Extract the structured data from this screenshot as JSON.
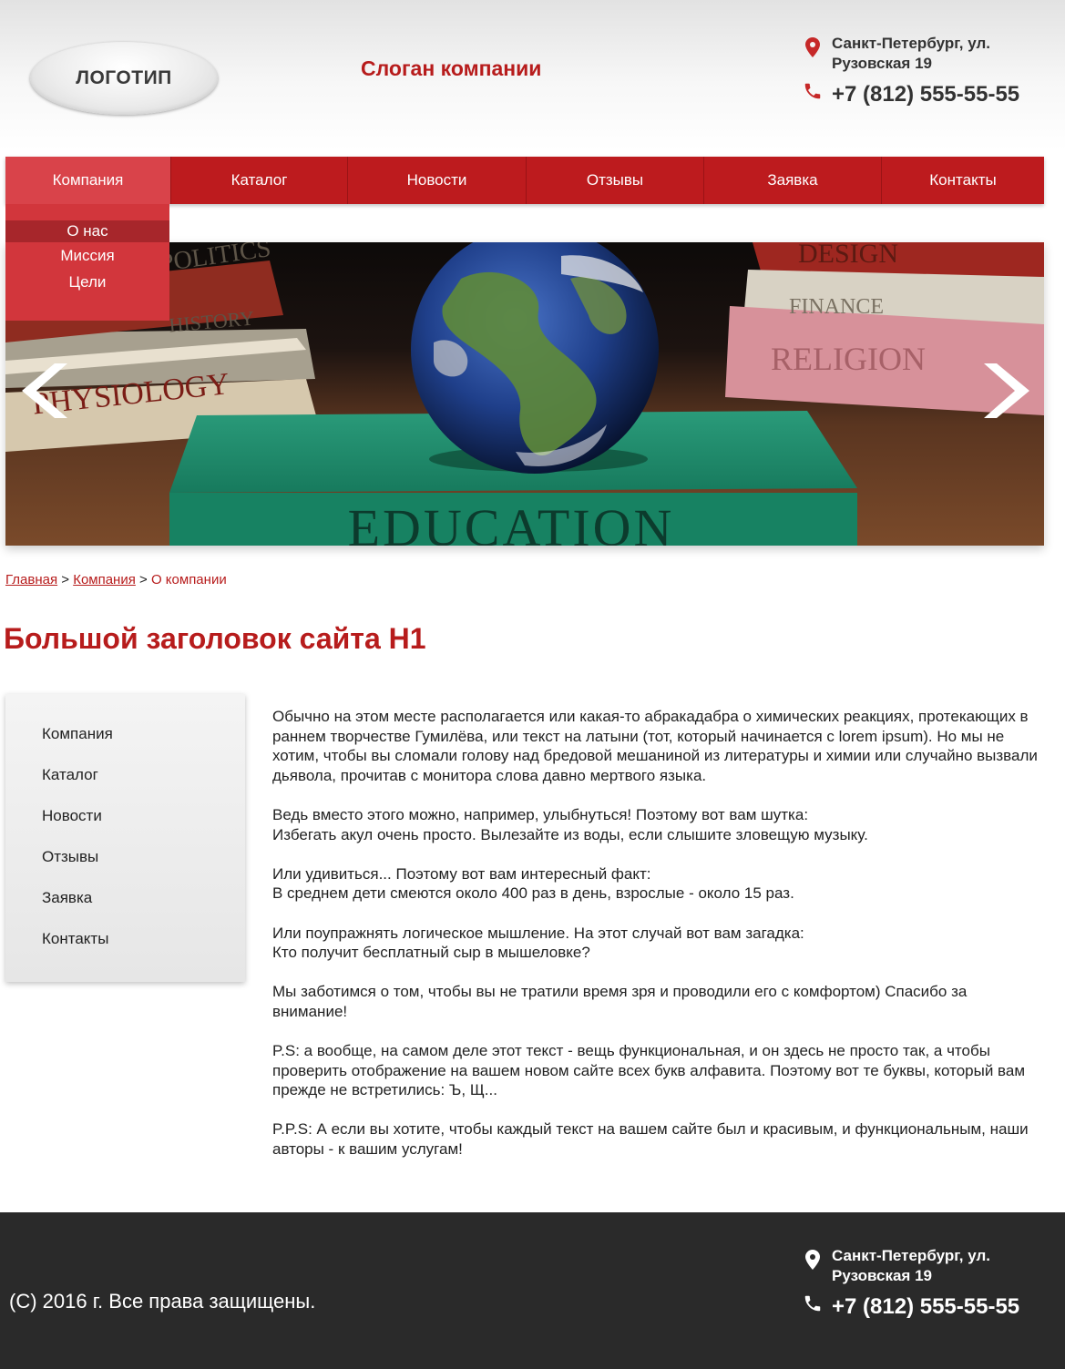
{
  "header": {
    "logo": "ЛОГОТИП",
    "slogan": "Слоган компании",
    "address": "Санкт-Петербург, ул. Рузовская 19",
    "phone": "+7 (812) 555-55-55"
  },
  "nav": {
    "items": [
      "Компания",
      "Каталог",
      "Новости",
      "Отзывы",
      "Заявка",
      "Контакты"
    ],
    "dropdown": [
      "О нас",
      "Миссия",
      "Цели"
    ]
  },
  "slider": {
    "book_text": "EDUCATION",
    "book_labels": [
      "PHYSIOLOGY",
      "HISTORY",
      "POLITICS",
      "DESIGN",
      "FINANCE",
      "RELIGION"
    ]
  },
  "breadcrumb": {
    "home": "Главная",
    "section": "Компания",
    "current": "О компании",
    "separator": ">"
  },
  "page_title": "Большой заголовок сайта H1",
  "sidebar": {
    "items": [
      "Компания",
      "Каталог",
      "Новости",
      "Отзывы",
      "Заявка",
      "Контакты"
    ]
  },
  "content": {
    "paragraphs": [
      [
        "Обычно на этом месте располагается или какая-то абракадабра о химических реакциях, протекающих в раннем творчестве Гумилёва, или текст на латыни (тот, который начинается с lorem ipsum). Но мы не хотим, чтобы вы сломали голову над бредовой мешаниной из литературы и химии или случайно вызвали дьявола, прочитав с монитора слова давно мертвого языка."
      ],
      [
        "Ведь вместо этого можно, например, улыбнуться! Поэтому вот вам шутка:",
        "Избегать акул очень просто. Вылезайте из воды, если слышите зловещую музыку."
      ],
      [
        "Или удивиться... Поэтому вот вам интересный факт:",
        "В среднем дети смеются около 400 раз в день, взрослые - около 15 раз."
      ],
      [
        "Или поупражнять логическое мышление. На этот случай вот вам загадка:",
        "Кто получит бесплатный сыр в мышеловке?"
      ],
      [
        "Мы заботимся о том, чтобы вы не тратили время зря и проводили его с комфортом) Спасибо за внимание!"
      ],
      [
        "P.S: а вообще, на самом деле этот текст - вещь функциональная, и он здесь не просто так, а чтобы проверить отображение на вашем новом сайте всех букв алфавита. Поэтому вот те буквы, который вам прежде не встретились: Ъ, Щ..."
      ],
      [
        "P.P.S: А если вы хотите, чтобы каждый текст на вашем сайте был и красивым, и функциональным, наши авторы - к вашим услугам!"
      ]
    ]
  },
  "footer": {
    "copyright": "(С) 2016 г. Все права защищены.",
    "address": "Санкт-Петербург, ул. Рузовская 19",
    "phone": "+7 (812) 555-55-55"
  },
  "colors": {
    "accent": "#bd1b1e",
    "accent_light": "#d9434a",
    "footer_bg": "#2a2a2a"
  },
  "icons": [
    "map-pin-icon",
    "phone-icon",
    "chevron-left-icon",
    "chevron-right-icon"
  ]
}
